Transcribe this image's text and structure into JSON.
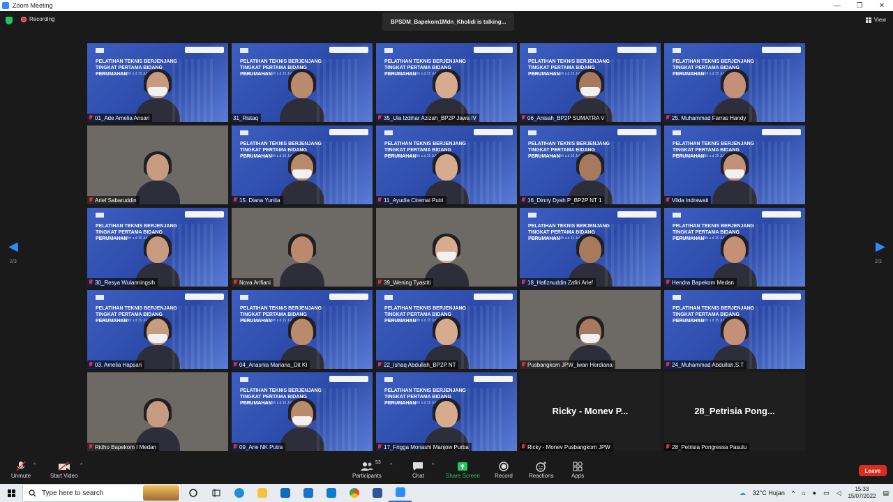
{
  "window": {
    "title": "Zoom Meeting",
    "controls": [
      "—",
      "❐",
      "✕"
    ]
  },
  "topbar": {
    "recording_label": "Recording",
    "talking_text": "BPSDM_Bapekom1Mdn_Kholidi is talking...",
    "view_label": "View"
  },
  "slide": {
    "title": "PELATIHAN TEKNIS BERJENJANG TINGKAT PERTAMA BIDANG PERUMAHAN",
    "subtitle": "Distance Learning | 5th s.d 15 Juli 2022"
  },
  "pager": {
    "left_count": "2/3",
    "right_count": "2/3",
    "left_arrow": "◀",
    "right_arrow": "▶"
  },
  "tiles": [
    {
      "name": "01_Ade Amelia Ansari",
      "kind": "slide",
      "muted": true
    },
    {
      "name": "31_Ristaq",
      "kind": "slide",
      "muted": false
    },
    {
      "name": "35_Ula Izdihar Azizah_BP2P Jawa IV",
      "kind": "slide",
      "muted": true
    },
    {
      "name": "06_Anisah_BP2P SUMATRA V",
      "kind": "slide",
      "muted": true
    },
    {
      "name": "25. Muhammad Farras Handy",
      "kind": "slide",
      "muted": true
    },
    {
      "name": "Arief Sabaruddin",
      "kind": "photo",
      "muted": true
    },
    {
      "name": "15. Diana Yunita",
      "kind": "slide",
      "muted": true
    },
    {
      "name": "11_Ayudia Ciremai Putri",
      "kind": "slide",
      "muted": true
    },
    {
      "name": "16_Dinny Dyah P_BP2P NT 1",
      "kind": "slide",
      "muted": true
    },
    {
      "name": "Vilda Indrawati",
      "kind": "slide",
      "muted": true
    },
    {
      "name": "30_Resya Wulanningsih",
      "kind": "slide",
      "muted": true
    },
    {
      "name": "Nova Arifiani",
      "kind": "photo",
      "muted": true
    },
    {
      "name": "39_Wening Tyastiti",
      "kind": "photo",
      "muted": true
    },
    {
      "name": "18_Hafiznuddin Zafiri Arief",
      "kind": "slide",
      "muted": true
    },
    {
      "name": "Hendra Bapekom Medan",
      "kind": "slide",
      "muted": true
    },
    {
      "name": "03. Amelia Hapsari",
      "kind": "slide",
      "muted": true
    },
    {
      "name": "04_Anasnia Mariana_Dit KI",
      "kind": "slide",
      "muted": true
    },
    {
      "name": "22_Ishaq Abdullah_BP2P NT",
      "kind": "slide",
      "muted": true
    },
    {
      "name": "Pusbangkom JPW_Iwan Herdiana",
      "kind": "photo",
      "muted": true
    },
    {
      "name": "24_Muhammad Abdullah,S.T",
      "kind": "slide",
      "muted": true
    },
    {
      "name": "Ridho Bapekom I Medan",
      "kind": "photo",
      "muted": true
    },
    {
      "name": "09_Arie NK Putra",
      "kind": "slide",
      "muted": true
    },
    {
      "name": "17_Frigga Monashi Manjow Purba",
      "kind": "slide",
      "muted": true
    },
    {
      "name": "Ricky - Monev Pusbangkom JPW",
      "kind": "dark",
      "bigname": "Ricky - Monev P...",
      "muted": true
    },
    {
      "name": "28_Petrisia Pongressa Pasulu",
      "kind": "dark",
      "bigname": "28_Petrisia Pong...",
      "muted": true
    }
  ],
  "toolbar": {
    "unmute": "Unmute",
    "start_video": "Start Video",
    "participants": "Participants",
    "participants_count": "53",
    "chat": "Chat",
    "share_screen": "Share Screen",
    "record": "Record",
    "reactions": "Reactions",
    "apps": "Apps",
    "leave": "Leave"
  },
  "taskbar": {
    "search_placeholder": "Type here to search",
    "weather": "32°C  Hujan",
    "time": "15:33",
    "date": "15/07/2022"
  },
  "colors": {
    "zoom_blue": "#2d8cff",
    "share_green": "#22c55e",
    "leave_red": "#d92d20",
    "muted_red": "#e03131"
  }
}
